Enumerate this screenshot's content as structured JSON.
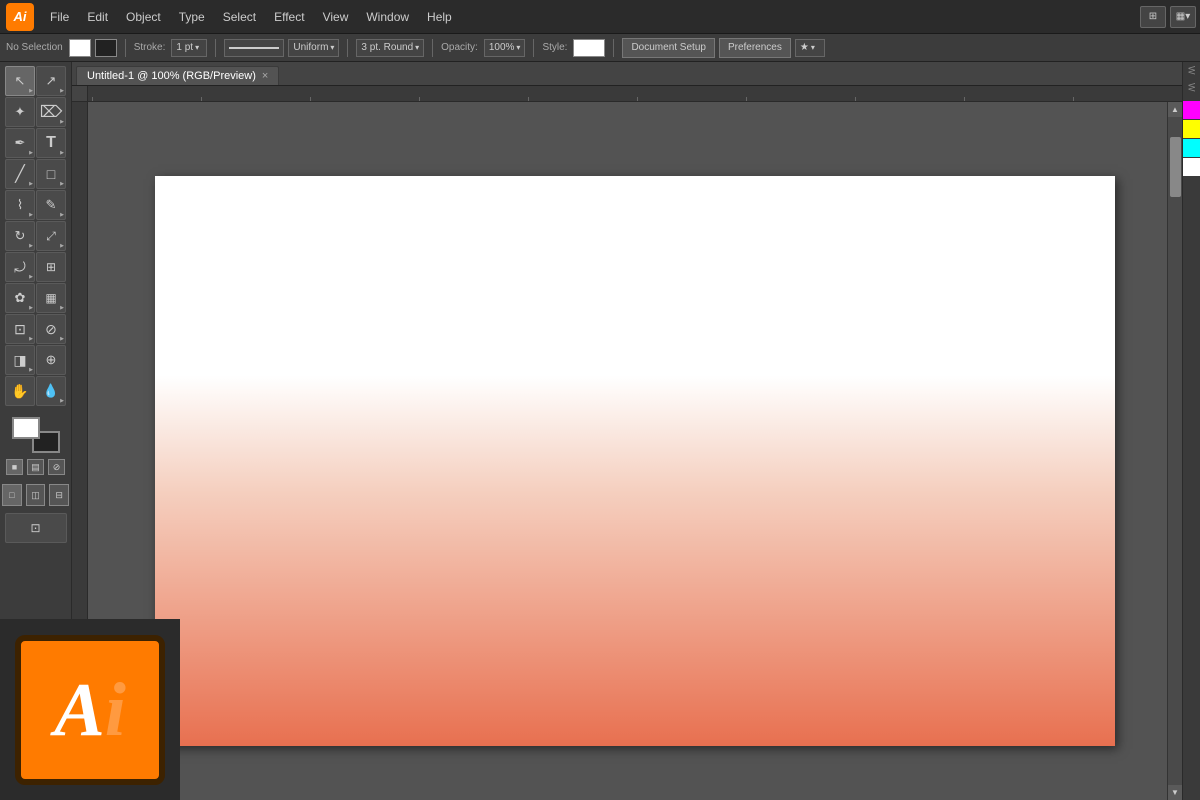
{
  "app": {
    "logo_text": "Ai",
    "title": "Adobe Illustrator"
  },
  "menu_bar": {
    "items": [
      "File",
      "Edit",
      "Object",
      "Type",
      "Select",
      "Effect",
      "View",
      "Window",
      "Help"
    ],
    "right_icons": [
      "⊞",
      "▦"
    ]
  },
  "control_bar": {
    "selection_label": "No Selection",
    "stroke_label": "Stroke:",
    "stroke_value": "1 pt",
    "uniform_label": "Uniform",
    "round_label": "3 pt. Round",
    "opacity_label": "Opacity:",
    "opacity_value": "100%",
    "style_label": "Style:",
    "doc_setup_btn": "Document Setup",
    "preferences_btn": "Preferences"
  },
  "tab": {
    "title": "Untitled-1 @ 100% (RGB/Preview)",
    "close": "×"
  },
  "tools": [
    {
      "name": "selection",
      "icon": "↖",
      "active": true
    },
    {
      "name": "direct-selection",
      "icon": "↗"
    },
    {
      "name": "magic-wand",
      "icon": "✦"
    },
    {
      "name": "lasso",
      "icon": "⌀"
    },
    {
      "name": "pen",
      "icon": "✒"
    },
    {
      "name": "type",
      "icon": "T"
    },
    {
      "name": "line",
      "icon": "/"
    },
    {
      "name": "rect",
      "icon": "□"
    },
    {
      "name": "paintbrush",
      "icon": "⌇"
    },
    {
      "name": "pencil",
      "icon": "✎"
    },
    {
      "name": "rotate",
      "icon": "↻"
    },
    {
      "name": "scale",
      "icon": "⤢"
    },
    {
      "name": "warp",
      "icon": "⤳"
    },
    {
      "name": "free-transform",
      "icon": "⊞"
    },
    {
      "name": "symbol-sprayer",
      "icon": "✿"
    },
    {
      "name": "column-graph",
      "icon": "▦"
    },
    {
      "name": "artboard",
      "icon": "⊡"
    },
    {
      "name": "slice",
      "icon": "⊘"
    },
    {
      "name": "eraser",
      "icon": "◨"
    },
    {
      "name": "zoom",
      "icon": "⊕"
    },
    {
      "name": "hand",
      "icon": "✋"
    },
    {
      "name": "eyedropper",
      "icon": "💧"
    }
  ],
  "colors": {
    "foreground": "#ffffff",
    "background": "#000000",
    "none_indicator": "⊘",
    "swap_icon": "⇄"
  },
  "canvas": {
    "artboard_gradient_start": "#ffffff",
    "artboard_gradient_end": "#e87050"
  },
  "right_panel": {
    "colors": [
      "#ff00ff",
      "#ffff00",
      "#00ffff",
      "#ffffff"
    ]
  },
  "splash": {
    "letter_a": "A",
    "letter_i": "i",
    "bg_color": "#2b2b2b",
    "box_color": "#FF7B00",
    "border_color": "#3d2200"
  }
}
